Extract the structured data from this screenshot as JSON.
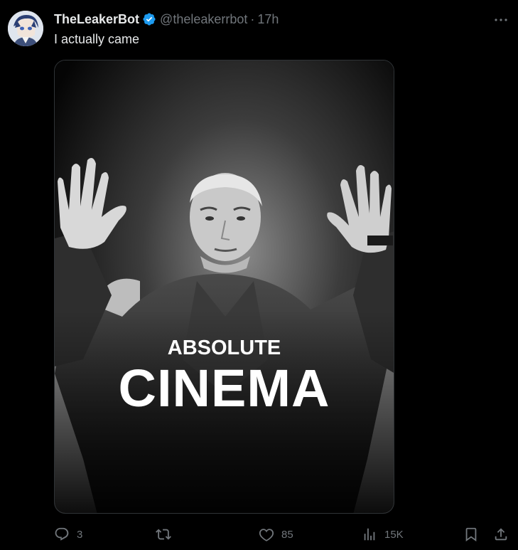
{
  "post": {
    "display_name": "TheLeakerBot",
    "handle": "@theleakerrbot",
    "separator": "·",
    "time": "17h",
    "text": "I actually came",
    "verified": true
  },
  "media": {
    "caption_small": "ABSOLUTE",
    "caption_large": "CINEMA"
  },
  "actions": {
    "replies": "3",
    "reposts": "",
    "likes": "85",
    "views": "15K"
  },
  "icons": {
    "more": "more-icon",
    "verified": "verified-badge-icon",
    "reply": "reply-icon",
    "repost": "repost-icon",
    "like": "heart-icon",
    "views": "analytics-icon",
    "bookmark": "bookmark-icon",
    "share": "share-icon"
  },
  "colors": {
    "background": "#000000",
    "text": "#e7e9ea",
    "muted": "#71767b",
    "verified": "#1d9bf0"
  }
}
